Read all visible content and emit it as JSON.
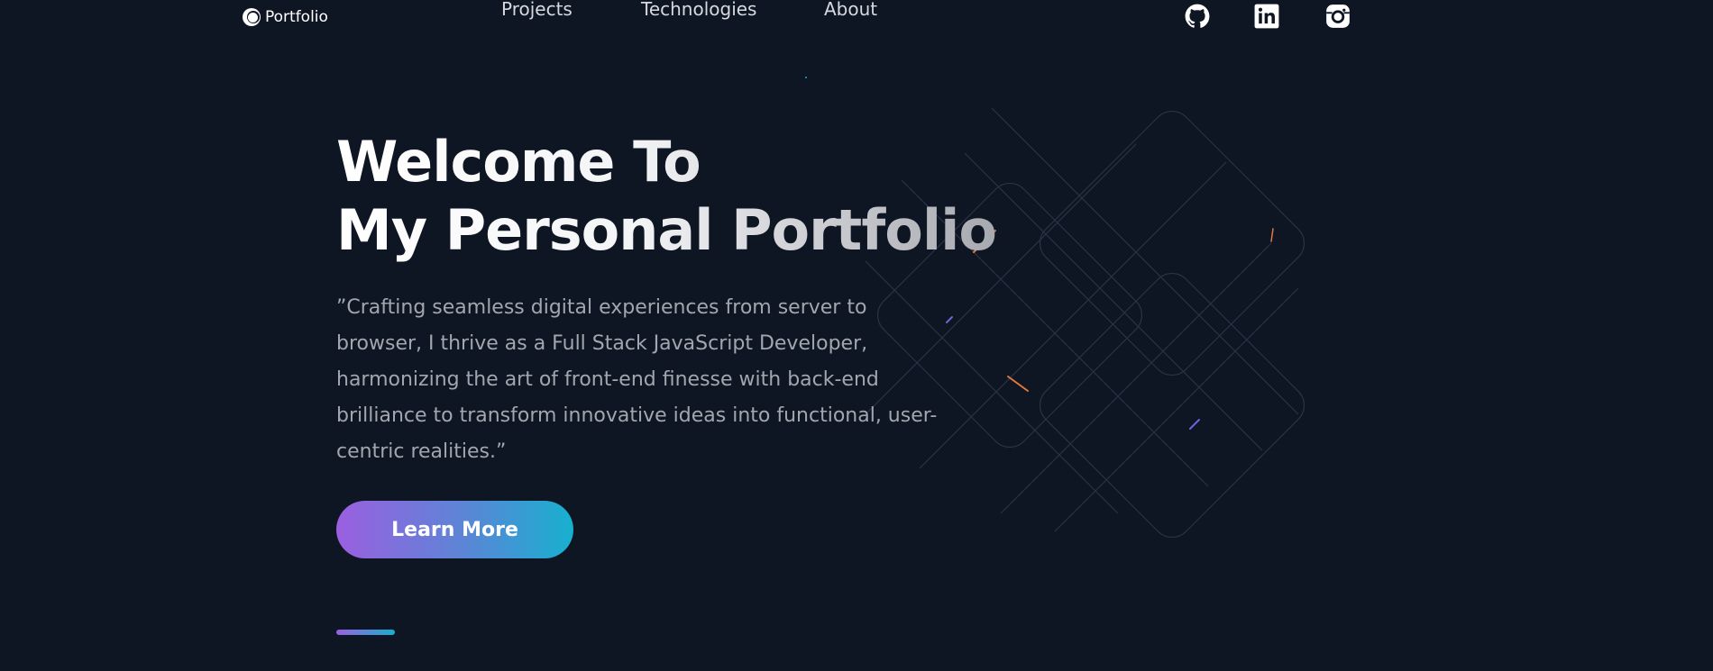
{
  "nav": {
    "logo_text": "Portfolio",
    "links": [
      {
        "label": "Projects"
      },
      {
        "label": "Technologies"
      },
      {
        "label": "About"
      }
    ],
    "social": [
      "github-icon",
      "linkedin-icon",
      "instagram-icon"
    ]
  },
  "hero": {
    "title_line1": "Welcome To",
    "title_line2": "My Personal Portfolio",
    "description": "”Crafting seamless digital experiences from server to browser, I thrive as a Full Stack JavaScript Developer, harmonizing the art of front-end finesse with back-end brilliance to transform innovative ideas into functional, user-centric realities.”",
    "button_label": "Learn More"
  },
  "colors": {
    "background": "#0f1623",
    "gradient_start": "#9b5fe0",
    "gradient_end": "#17b0cf",
    "text_muted": "#a2a6ae"
  }
}
